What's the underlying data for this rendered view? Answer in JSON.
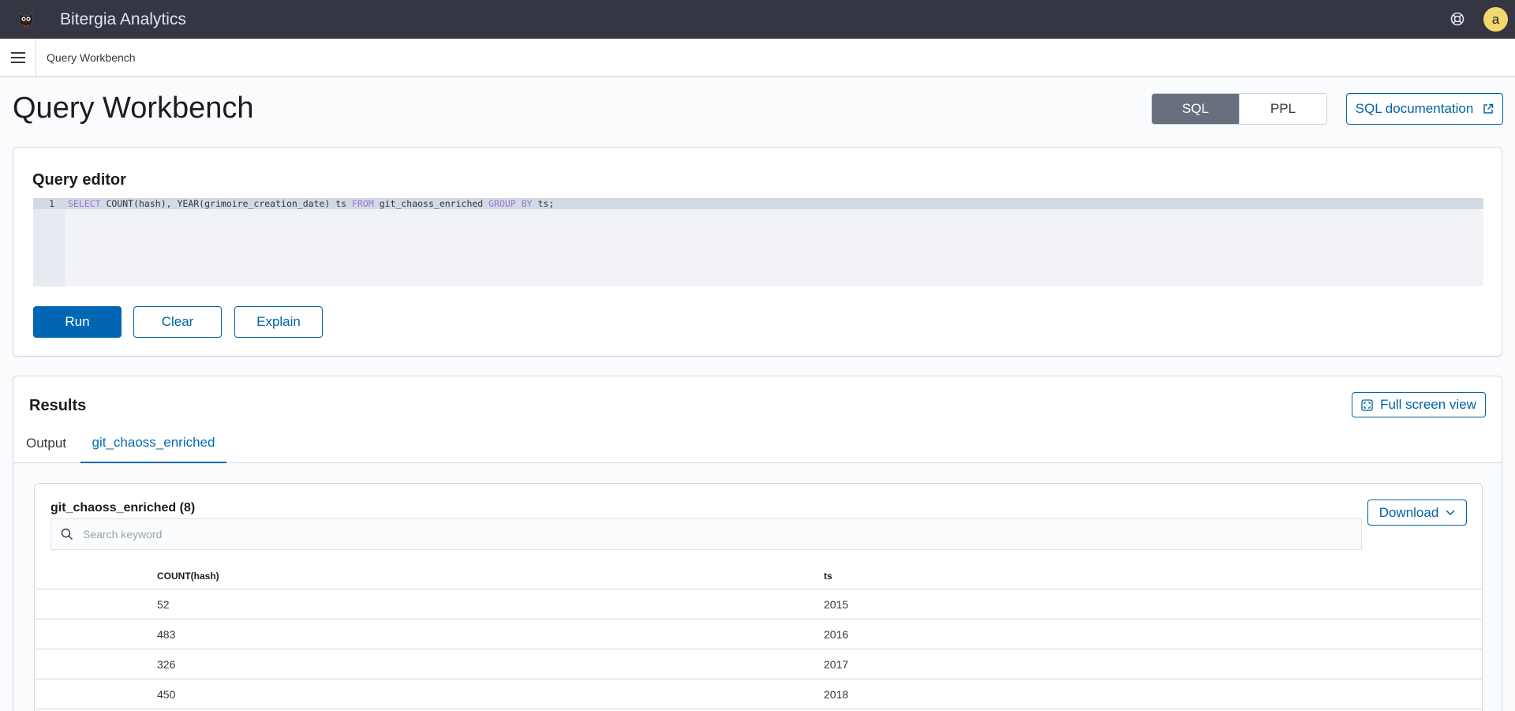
{
  "app": {
    "title": "Bitergia Analytics",
    "user_initial": "a"
  },
  "breadcrumb": {
    "current": "Query Workbench"
  },
  "page": {
    "title": "Query Workbench"
  },
  "language_toggle": {
    "options": [
      "SQL",
      "PPL"
    ],
    "selected": "SQL"
  },
  "docs_button": {
    "label": "SQL documentation"
  },
  "editor": {
    "title": "Query editor",
    "line_number": "1",
    "query": {
      "select": "SELECT",
      "count": " COUNT(hash), YEAR(grimoire_creation_date) ts ",
      "from": "FROM",
      "table": " git_chaoss_enriched ",
      "group_by": "GROUP BY",
      "tail": " ts;"
    },
    "buttons": {
      "run": "Run",
      "clear": "Clear",
      "explain": "Explain"
    }
  },
  "results": {
    "title": "Results",
    "fullscreen_label": "Full screen view",
    "tabs": [
      "Output",
      "git_chaoss_enriched"
    ],
    "active_tab": "git_chaoss_enriched",
    "table": {
      "title": "git_chaoss_enriched (8)",
      "download_label": "Download",
      "search_placeholder": "Search keyword",
      "columns": [
        "COUNT(hash)",
        "ts"
      ],
      "rows": [
        [
          "52",
          "2015"
        ],
        [
          "483",
          "2016"
        ],
        [
          "326",
          "2017"
        ],
        [
          "450",
          "2018"
        ]
      ]
    }
  },
  "icons": {
    "logo": "owl-logo-icon",
    "help": "help-icon",
    "menu": "hamburger-menu-icon",
    "external": "external-link-icon",
    "fullscreen": "fullscreen-icon",
    "search": "search-icon",
    "chevron": "chevron-down-icon"
  },
  "colors": {
    "header": "#343741",
    "primary": "#0066b3",
    "avatar": "#f1d86f"
  }
}
